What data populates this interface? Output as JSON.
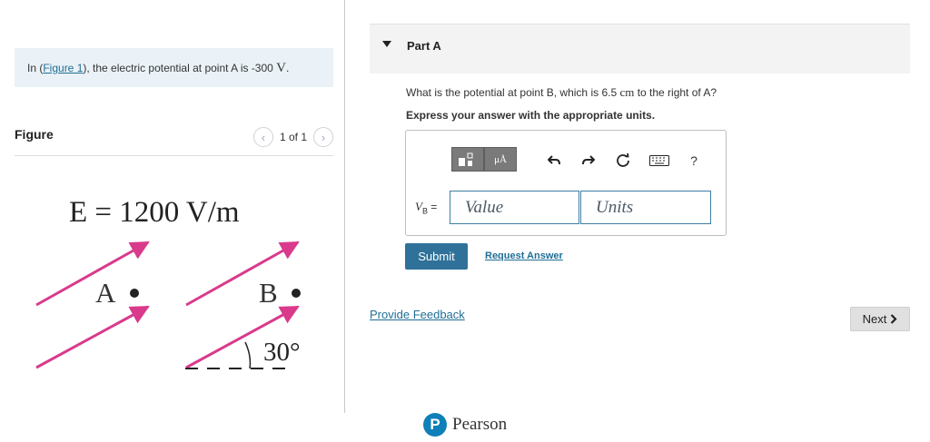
{
  "intro": {
    "prefix": "In (",
    "figure_link": "Figure 1",
    "middle": "), the electric potential at point A is -300 ",
    "unit": "V",
    "suffix": "."
  },
  "figure": {
    "title": "Figure",
    "pager_text": "1 of 1",
    "prev_icon": "chevron-left-icon",
    "next_icon": "chevron-right-icon",
    "field_equation": "E = 1200 V/m",
    "point_a": "A",
    "point_b": "B",
    "angle": "30°",
    "arrow_color": "#d93a8c"
  },
  "part": {
    "title": "Part A",
    "question_before": "What is the potential at point B, which is 6.5 ",
    "question_unit": "cm",
    "question_after": " to the right of A?",
    "instruction": "Express your answer with the appropriate units."
  },
  "toolbar": {
    "template_icon": "templates-icon",
    "units_btn": "μÅ",
    "undo_icon": "undo-icon",
    "redo_icon": "redo-icon",
    "reset_icon": "reset-icon",
    "keyboard_icon": "keyboard-icon",
    "help": "?"
  },
  "answer": {
    "label_symbol": "V",
    "label_sub": "B",
    "label_eq": " =",
    "value_placeholder": "Value",
    "units_placeholder": "Units"
  },
  "actions": {
    "submit": "Submit",
    "request_answer": "Request Answer",
    "feedback": "Provide Feedback",
    "next": "Next"
  },
  "brand": {
    "logo_letter": "P",
    "name": "Pearson",
    "color": "#0f7fb7"
  },
  "colors": {
    "accent": "#2f7199",
    "link": "#1f6e95"
  }
}
